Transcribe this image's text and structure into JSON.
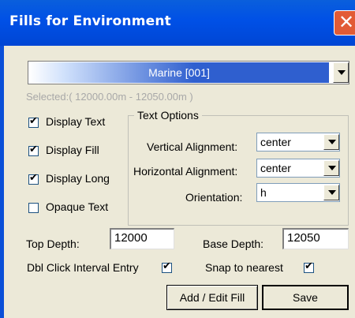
{
  "window": {
    "title": "Fills for Environment",
    "close_glyph": "✕"
  },
  "fill_select": {
    "value": "Marine [001]",
    "selected_range": "Selected:( 12000.00m - 12050.00m )"
  },
  "display_options": [
    {
      "label": "Display Text",
      "checked": true
    },
    {
      "label": "Display Fill",
      "checked": true
    },
    {
      "label": "Display Long",
      "checked": true
    },
    {
      "label": "Opaque Text",
      "checked": false
    }
  ],
  "text_options": {
    "title": "Text Options",
    "vertical_alignment": {
      "label": "Vertical Alignment:",
      "value": "center"
    },
    "horizontal_alignment": {
      "label": "Horizontal Alignment:",
      "value": "center"
    },
    "orientation": {
      "label": "Orientation:",
      "value": "h"
    }
  },
  "depth": {
    "top_label": "Top Depth:",
    "top_value": "12000",
    "base_label": "Base Depth:",
    "base_value": "12050"
  },
  "options": {
    "dbl_click_label": "Dbl Click Interval Entry",
    "dbl_click_checked": true,
    "snap_label": "Snap to nearest",
    "snap_checked": true
  },
  "buttons": {
    "add_edit": "Add / Edit Fill",
    "save": "Save"
  },
  "colors": {
    "titlebar": "#0050e6",
    "close": "#e25b36",
    "fill_swatch": "#2f5fcf",
    "dialog_bg": "#ece9d8"
  },
  "check_glyph": "✔"
}
